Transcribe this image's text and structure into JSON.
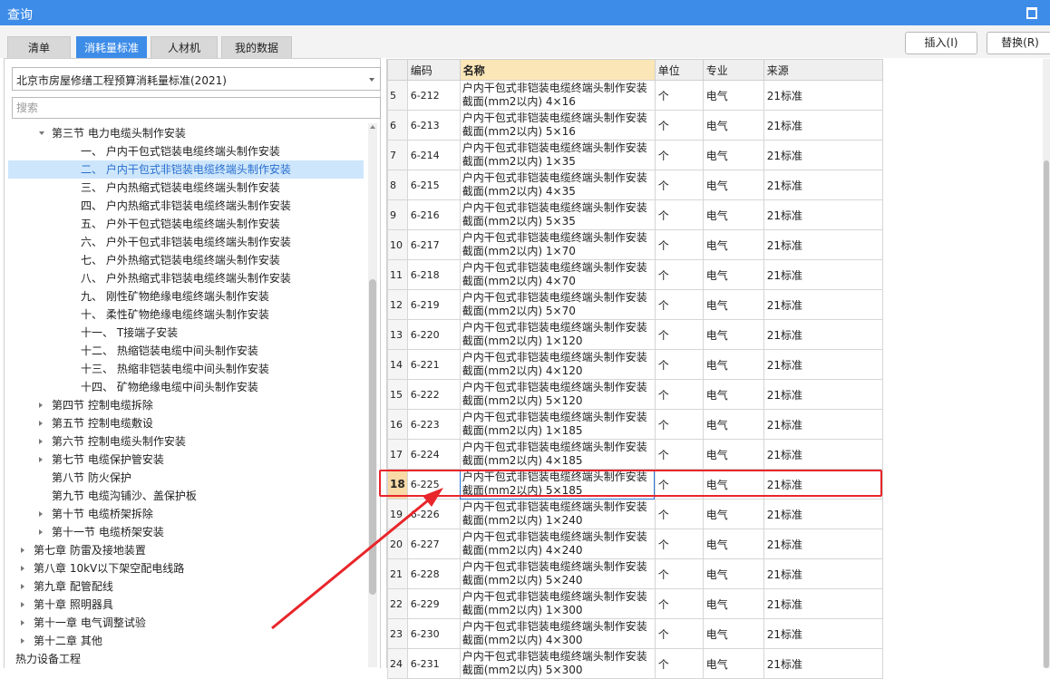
{
  "window": {
    "title": "查询"
  },
  "tabs": [
    {
      "label": "清单",
      "active": false
    },
    {
      "label": "消耗量标准",
      "active": true
    },
    {
      "label": "人材机",
      "active": false
    },
    {
      "label": "我的数据",
      "active": false
    }
  ],
  "toolbar": {
    "insert_label": "插入(I)",
    "replace_label": "替换(R)"
  },
  "left": {
    "standard_select": "北京市房屋修缮工程预算消耗量标准(2021)",
    "search_placeholder": "搜索"
  },
  "tree": [
    {
      "label": "第三节 电力电缆头制作安装",
      "level": 2,
      "toggle": "down",
      "selected": false
    },
    {
      "label": "一、 户内干包式铠装电缆终端头制作安装",
      "level": 4,
      "toggle": "none",
      "selected": false
    },
    {
      "label": "二、 户内干包式非铠装电缆终端头制作安装",
      "level": 4,
      "toggle": "none",
      "selected": true
    },
    {
      "label": "三、 户内热缩式铠装电缆终端头制作安装",
      "level": 4,
      "toggle": "none",
      "selected": false
    },
    {
      "label": "四、 户内热缩式非铠装电缆终端头制作安装",
      "level": 4,
      "toggle": "none",
      "selected": false
    },
    {
      "label": "五、 户外干包式铠装电缆终端头制作安装",
      "level": 4,
      "toggle": "none",
      "selected": false
    },
    {
      "label": "六、 户外干包式非铠装电缆终端头制作安装",
      "level": 4,
      "toggle": "none",
      "selected": false
    },
    {
      "label": "七、 户外热缩式铠装电缆终端头制作安装",
      "level": 4,
      "toggle": "none",
      "selected": false
    },
    {
      "label": "八、 户外热缩式非铠装电缆终端头制作安装",
      "level": 4,
      "toggle": "none",
      "selected": false
    },
    {
      "label": "九、 刚性矿物绝缘电缆终端头制作安装",
      "level": 4,
      "toggle": "none",
      "selected": false
    },
    {
      "label": "十、 柔性矿物绝缘电缆终端头制作安装",
      "level": 4,
      "toggle": "none",
      "selected": false
    },
    {
      "label": "十一、 T接端子安装",
      "level": 4,
      "toggle": "none",
      "selected": false
    },
    {
      "label": "十二、 热缩铠装电缆中间头制作安装",
      "level": 4,
      "toggle": "none",
      "selected": false
    },
    {
      "label": "十三、 热缩非铠装电缆中间头制作安装",
      "level": 4,
      "toggle": "none",
      "selected": false
    },
    {
      "label": "十四、 矿物绝缘电缆中间头制作安装",
      "level": 4,
      "toggle": "none",
      "selected": false
    },
    {
      "label": "第四节 控制电缆拆除",
      "level": 2,
      "toggle": "right",
      "selected": false
    },
    {
      "label": "第五节 控制电缆敷设",
      "level": 2,
      "toggle": "right",
      "selected": false
    },
    {
      "label": "第六节 控制电缆头制作安装",
      "level": 2,
      "toggle": "right",
      "selected": false
    },
    {
      "label": "第七节 电缆保护管安装",
      "level": 2,
      "toggle": "right",
      "selected": false
    },
    {
      "label": "第八节 防火保护",
      "level": 2,
      "toggle": "none",
      "selected": false
    },
    {
      "label": "第九节 电缆沟铺沙、盖保护板",
      "level": 2,
      "toggle": "none",
      "selected": false
    },
    {
      "label": "第十节 电缆桥架拆除",
      "level": 2,
      "toggle": "right",
      "selected": false
    },
    {
      "label": "第十一节 电缆桥架安装",
      "level": 2,
      "toggle": "right",
      "selected": false
    },
    {
      "label": "第七章 防雷及接地装置",
      "level": 1,
      "toggle": "right",
      "selected": false
    },
    {
      "label": "第八章 10kV以下架空配电线路",
      "level": 1,
      "toggle": "right",
      "selected": false
    },
    {
      "label": "第九章 配管配线",
      "level": 1,
      "toggle": "right",
      "selected": false
    },
    {
      "label": "第十章 照明器具",
      "level": 1,
      "toggle": "right",
      "selected": false
    },
    {
      "label": "第十一章 电气调整试验",
      "level": 1,
      "toggle": "right",
      "selected": false
    },
    {
      "label": "第十二章 其他",
      "level": 1,
      "toggle": "right",
      "selected": false
    },
    {
      "label": "热力设备工程",
      "level": 0,
      "toggle": "right",
      "selected": false
    }
  ],
  "grid": {
    "headers": {
      "code": "编码",
      "name": "名称",
      "unit": "单位",
      "specialty": "专业",
      "source": "来源"
    },
    "rows": [
      {
        "idx": "5",
        "code": "6-212",
        "name1": "户内干包式非铠装电缆终端头制作安装",
        "name2": "截面(mm2以内) 4×16",
        "unit": "个",
        "specialty": "电气",
        "source": "21标准"
      },
      {
        "idx": "6",
        "code": "6-213",
        "name1": "户内干包式非铠装电缆终端头制作安装",
        "name2": "截面(mm2以内) 5×16",
        "unit": "个",
        "specialty": "电气",
        "source": "21标准"
      },
      {
        "idx": "7",
        "code": "6-214",
        "name1": "户内干包式非铠装电缆终端头制作安装",
        "name2": "截面(mm2以内) 1×35",
        "unit": "个",
        "specialty": "电气",
        "source": "21标准"
      },
      {
        "idx": "8",
        "code": "6-215",
        "name1": "户内干包式非铠装电缆终端头制作安装",
        "name2": "截面(mm2以内) 4×35",
        "unit": "个",
        "specialty": "电气",
        "source": "21标准"
      },
      {
        "idx": "9",
        "code": "6-216",
        "name1": "户内干包式非铠装电缆终端头制作安装",
        "name2": "截面(mm2以内) 5×35",
        "unit": "个",
        "specialty": "电气",
        "source": "21标准"
      },
      {
        "idx": "10",
        "code": "6-217",
        "name1": "户内干包式非铠装电缆终端头制作安装",
        "name2": "截面(mm2以内) 1×70",
        "unit": "个",
        "specialty": "电气",
        "source": "21标准"
      },
      {
        "idx": "11",
        "code": "6-218",
        "name1": "户内干包式非铠装电缆终端头制作安装",
        "name2": "截面(mm2以内) 4×70",
        "unit": "个",
        "specialty": "电气",
        "source": "21标准"
      },
      {
        "idx": "12",
        "code": "6-219",
        "name1": "户内干包式非铠装电缆终端头制作安装",
        "name2": "截面(mm2以内) 5×70",
        "unit": "个",
        "specialty": "电气",
        "source": "21标准"
      },
      {
        "idx": "13",
        "code": "6-220",
        "name1": "户内干包式非铠装电缆终端头制作安装",
        "name2": "截面(mm2以内) 1×120",
        "unit": "个",
        "specialty": "电气",
        "source": "21标准"
      },
      {
        "idx": "14",
        "code": "6-221",
        "name1": "户内干包式非铠装电缆终端头制作安装",
        "name2": "截面(mm2以内) 4×120",
        "unit": "个",
        "specialty": "电气",
        "source": "21标准"
      },
      {
        "idx": "15",
        "code": "6-222",
        "name1": "户内干包式非铠装电缆终端头制作安装",
        "name2": "截面(mm2以内) 5×120",
        "unit": "个",
        "specialty": "电气",
        "source": "21标准"
      },
      {
        "idx": "16",
        "code": "6-223",
        "name1": "户内干包式非铠装电缆终端头制作安装",
        "name2": "截面(mm2以内) 1×185",
        "unit": "个",
        "specialty": "电气",
        "source": "21标准"
      },
      {
        "idx": "17",
        "code": "6-224",
        "name1": "户内干包式非铠装电缆终端头制作安装",
        "name2": "截面(mm2以内) 4×185",
        "unit": "个",
        "specialty": "电气",
        "source": "21标准"
      },
      {
        "idx": "18",
        "code": "6-225",
        "name1": "户内干包式非铠装电缆终端头制作安装",
        "name2": "截面(mm2以内) 5×185",
        "unit": "个",
        "specialty": "电气",
        "source": "21标准",
        "current": true
      },
      {
        "idx": "19",
        "code": "6-226",
        "name1": "户内干包式非铠装电缆终端头制作安装",
        "name2": "截面(mm2以内) 1×240",
        "unit": "个",
        "specialty": "电气",
        "source": "21标准"
      },
      {
        "idx": "20",
        "code": "6-227",
        "name1": "户内干包式非铠装电缆终端头制作安装",
        "name2": "截面(mm2以内) 4×240",
        "unit": "个",
        "specialty": "电气",
        "source": "21标准"
      },
      {
        "idx": "21",
        "code": "6-228",
        "name1": "户内干包式非铠装电缆终端头制作安装",
        "name2": "截面(mm2以内) 5×240",
        "unit": "个",
        "specialty": "电气",
        "source": "21标准"
      },
      {
        "idx": "22",
        "code": "6-229",
        "name1": "户内干包式非铠装电缆终端头制作安装",
        "name2": "截面(mm2以内) 1×300",
        "unit": "个",
        "specialty": "电气",
        "source": "21标准"
      },
      {
        "idx": "23",
        "code": "6-230",
        "name1": "户内干包式非铠装电缆终端头制作安装",
        "name2": "截面(mm2以内) 4×300",
        "unit": "个",
        "specialty": "电气",
        "source": "21标准"
      },
      {
        "idx": "24",
        "code": "6-231",
        "name1": "户内干包式非铠装电缆终端头制作安装",
        "name2": "截面(mm2以内) 5×300",
        "unit": "个",
        "specialty": "电气",
        "source": "21标准"
      }
    ]
  },
  "colors": {
    "accent": "#3d8ce8",
    "annotation": "#e8252a",
    "tree_selected_bg": "#cde6fb",
    "name_header_bg": "#fbe6b8",
    "current_index_bg": "#f9d9a6"
  }
}
